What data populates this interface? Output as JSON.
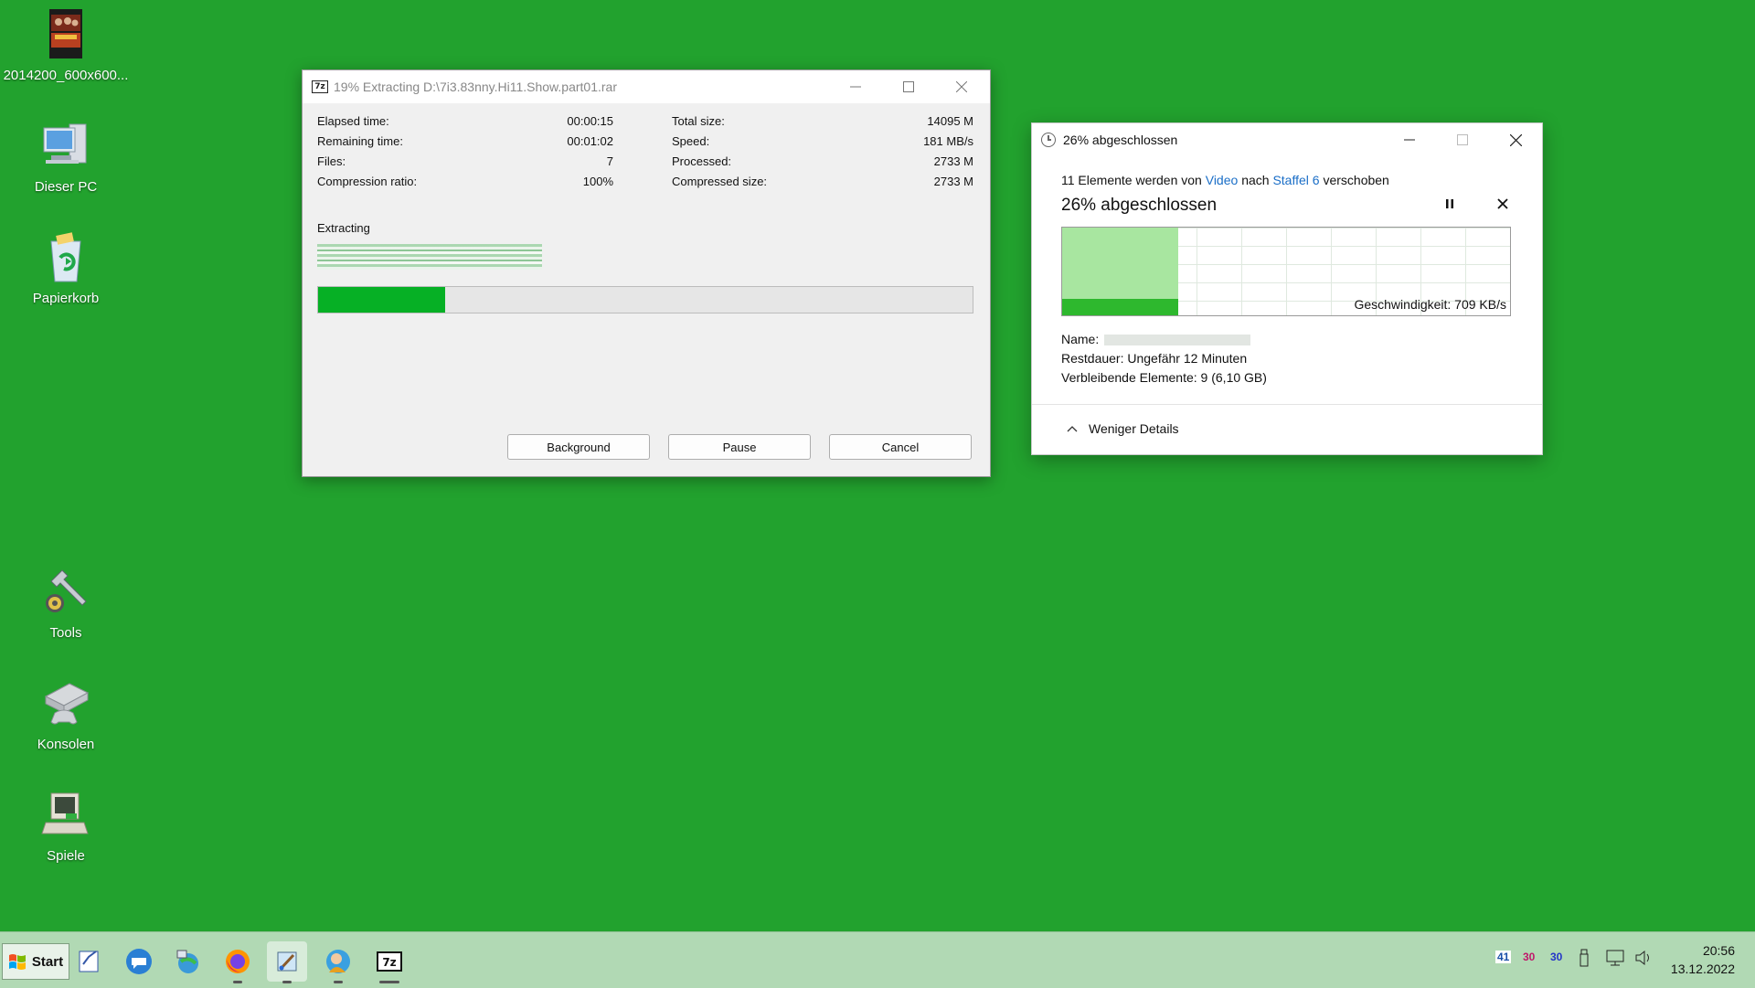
{
  "desktop": {
    "icons": [
      {
        "label": "2014200_600x600..."
      },
      {
        "label": "Dieser PC"
      },
      {
        "label": "Papierkorb"
      },
      {
        "label": "Tools"
      },
      {
        "label": "Konsolen"
      },
      {
        "label": "Spiele"
      }
    ]
  },
  "sevenzip": {
    "app_icon_text": "7z",
    "title": "19% Extracting D:\\7i3.83nny.Hi11.Show.part01.rar",
    "left_stats": [
      {
        "label": "Elapsed time:",
        "value": "00:00:15"
      },
      {
        "label": "Remaining time:",
        "value": "00:01:02"
      },
      {
        "label": "Files:",
        "value": "7"
      },
      {
        "label": "Compression ratio:",
        "value": "100%"
      }
    ],
    "right_stats": [
      {
        "label": "Total size:",
        "value": "14095 M"
      },
      {
        "label": "Speed:",
        "value": "181 MB/s"
      },
      {
        "label": "Processed:",
        "value": "2733 M"
      },
      {
        "label": "Compressed size:",
        "value": "2733 M"
      }
    ],
    "section_label": "Extracting",
    "progress_percent": 19.4,
    "buttons": {
      "background": "Background",
      "pause": "Pause",
      "cancel": "Cancel"
    },
    "progress_color": "#06b025"
  },
  "copy_dialog": {
    "title": "26% abgeschlossen",
    "line_prefix": "11 Elemente werden von",
    "source": "Video",
    "line_mid": "nach",
    "destination": "Staffel 6",
    "line_suffix": "verschoben",
    "percent_text": "26% abgeschlossen",
    "progress_percent": 26,
    "speed_text": "Geschwindigkeit: 709 KB/s",
    "name_label": "Name:",
    "remaining_time": "Restdauer: Ungefähr 12 Minuten",
    "remaining_items": "Verbleibende Elemente: 9 (6,10 GB)",
    "details_toggle": "Weniger Details",
    "link_color": "#1a6ec7"
  },
  "taskbar": {
    "start_label": "Start",
    "apps": [
      "notes-app-icon",
      "chat-app-icon",
      "network-globe-icon",
      "firefox-icon",
      "paint-brush-app-icon",
      "user-globe-icon",
      "7zip-icon"
    ],
    "tray": {
      "item1": "41",
      "item2": "30",
      "item3": "30"
    },
    "clock": {
      "time": "20:56",
      "date": "13.12.2022"
    }
  }
}
